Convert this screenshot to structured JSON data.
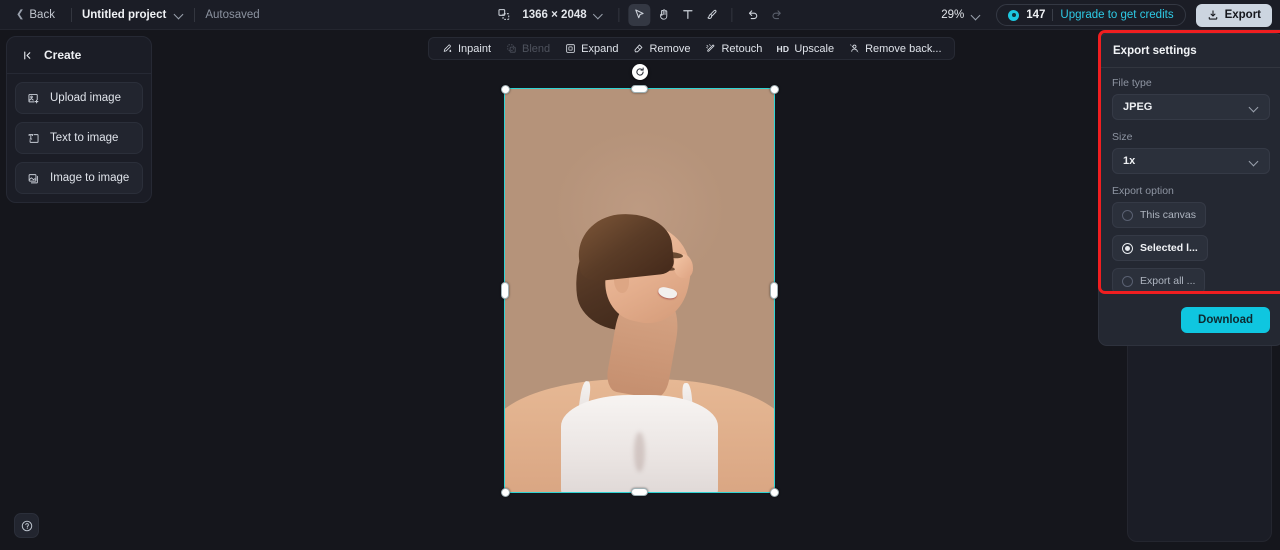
{
  "topbar": {
    "back_label": "Back",
    "project_name": "Untitled project",
    "autosaved_label": "Autosaved",
    "canvas_dimensions": "1366 × 2048",
    "zoom_level": "29%",
    "credits_count": "147",
    "upgrade_label": "Upgrade to get credits",
    "export_label": "Export",
    "tools": [
      {
        "name": "resize-icon",
        "label": "Resize"
      },
      {
        "name": "select-tool",
        "label": "Select",
        "active": true
      },
      {
        "name": "hand-tool",
        "label": "Hand"
      },
      {
        "name": "text-tool",
        "label": "Text"
      },
      {
        "name": "brush-tool",
        "label": "Brush"
      },
      {
        "name": "undo-button",
        "label": "Undo"
      },
      {
        "name": "redo-button",
        "label": "Redo"
      }
    ]
  },
  "sidebar": {
    "header": "Create",
    "items": [
      {
        "label": "Upload image",
        "icon": "upload-image-icon"
      },
      {
        "label": "Text to image",
        "icon": "text-to-image-icon"
      },
      {
        "label": "Image to image",
        "icon": "image-to-image-icon"
      }
    ]
  },
  "help": {
    "label": "?"
  },
  "float_toolbar": {
    "items": [
      {
        "label": "Inpaint",
        "icon": "inpaint-icon",
        "disabled": false
      },
      {
        "label": "Blend",
        "icon": "blend-icon",
        "disabled": true
      },
      {
        "label": "Expand",
        "icon": "expand-icon",
        "disabled": false
      },
      {
        "label": "Remove",
        "icon": "remove-icon",
        "disabled": false
      },
      {
        "label": "Retouch",
        "icon": "retouch-icon",
        "disabled": false
      },
      {
        "label": "Upscale",
        "icon": "upscale-icon",
        "badge": "HD",
        "disabled": false
      },
      {
        "label": "Remove back...",
        "icon": "remove-background-icon",
        "disabled": false
      }
    ]
  },
  "export_settings": {
    "title": "Export settings",
    "file_type_label": "File type",
    "file_type_value": "JPEG",
    "size_label": "Size",
    "size_value": "1x",
    "export_option_label": "Export option",
    "options": [
      {
        "label": "This canvas",
        "selected": false
      },
      {
        "label": "Selected l...",
        "selected": true
      },
      {
        "label": "Export all ...",
        "selected": false
      }
    ],
    "download_label": "Download"
  },
  "colors": {
    "accent_cyan": "#0fc6e0",
    "link_cyan": "#2ecbe6",
    "highlight_red": "#f01e20",
    "selection_outline": "#2fd4d4",
    "canvas_bg": "#15161c",
    "panel_bg": "#1b1d26",
    "image_bg": "#b5937a"
  }
}
